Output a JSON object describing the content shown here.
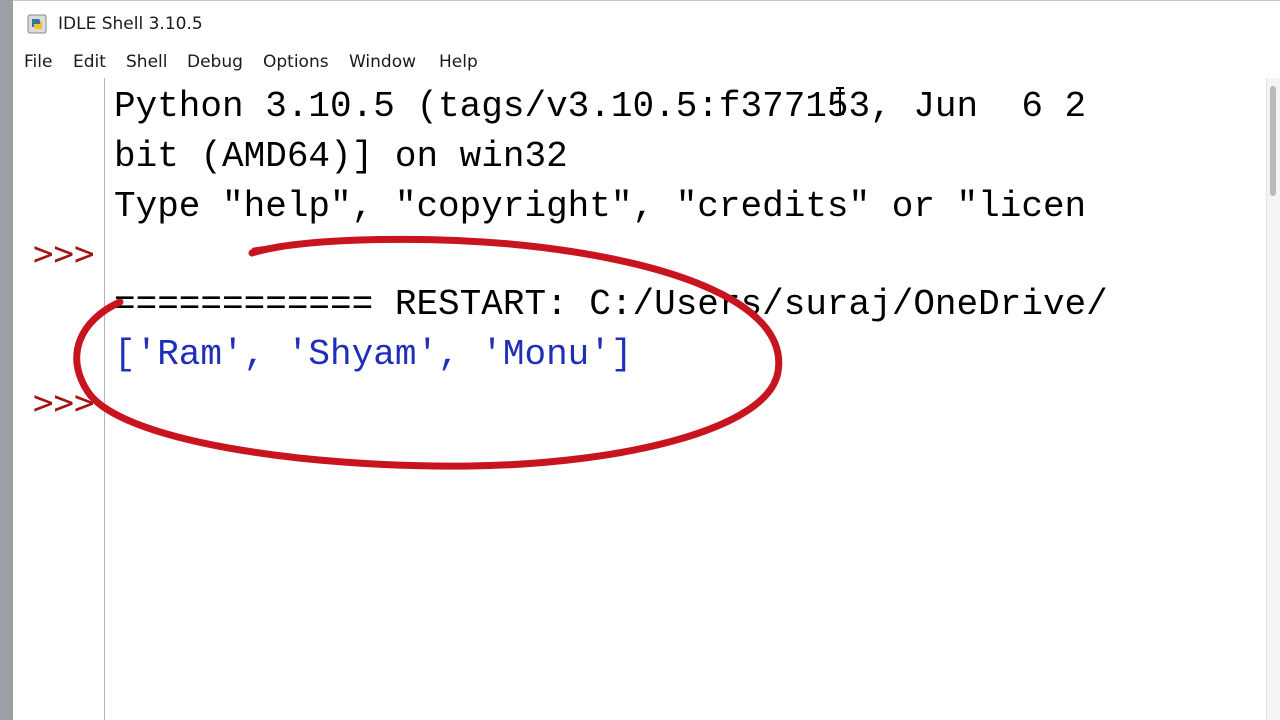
{
  "window": {
    "title": "IDLE Shell 3.10.5",
    "icon": "python-icon"
  },
  "menu": [
    "File",
    "Edit",
    "Shell",
    "Debug",
    "Options",
    "Window",
    "Help"
  ],
  "shell": {
    "lines": [
      "Python 3.10.5 (tags/v3.10.5:f377153, Jun  6 2",
      "bit (AMD64)] on win32",
      "Type \"help\", \"copyright\", \"credits\" or \"licen",
      "",
      "============ RESTART: C:/Users/suraj/OneDrive/",
      "['Ram', 'Shyam', 'Monu']"
    ],
    "prompts": [
      ">>>",
      ">>>"
    ]
  },
  "colors": {
    "prompt": "#a31515",
    "output": "#1f2fb8",
    "annotation": "#c8141e"
  }
}
